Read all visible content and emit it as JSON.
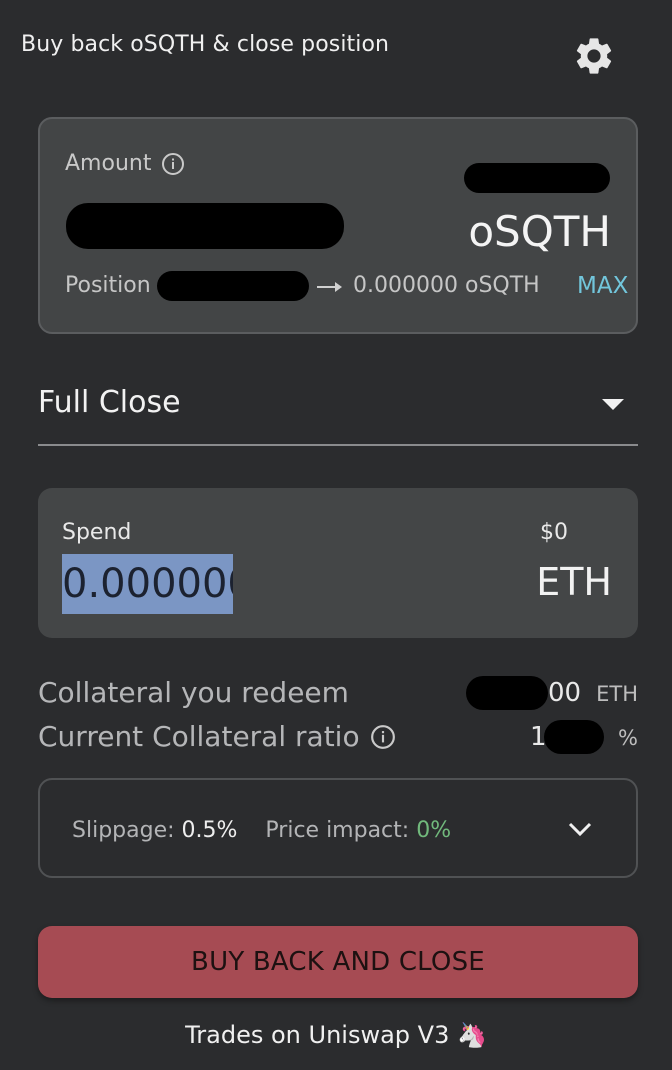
{
  "header": {
    "title": "Buy back oSQTH & close position"
  },
  "amount": {
    "label": "Amount",
    "unit": "oSQTH",
    "position_label": "Position",
    "position_after": "0.000000",
    "position_after_unit": "oSQTH",
    "max_label": "MAX"
  },
  "close_type": {
    "selected": "Full Close"
  },
  "spend": {
    "label": "Spend",
    "usd_value": "$0",
    "amount": "0.000000",
    "unit": "ETH"
  },
  "info": {
    "collateral_redeem_label": "Collateral you redeem",
    "collateral_redeem_visible": "00",
    "collateral_redeem_unit": "ETH",
    "collateral_ratio_label": "Current Collateral ratio",
    "collateral_ratio_visible": "1",
    "collateral_ratio_unit": "%"
  },
  "trade_details": {
    "slippage_label": "Slippage:",
    "slippage_value": "0.5%",
    "impact_label": "Price impact:",
    "impact_value": "0%"
  },
  "cta": {
    "label": "BUY BACK AND CLOSE"
  },
  "footer": {
    "text": "Trades on Uniswap V3 🦄"
  },
  "colors": {
    "accent_blue": "#72c6dc",
    "cta_red": "#a64b53",
    "impact_green": "#71b97c",
    "selection_blue": "#7b96c4"
  }
}
